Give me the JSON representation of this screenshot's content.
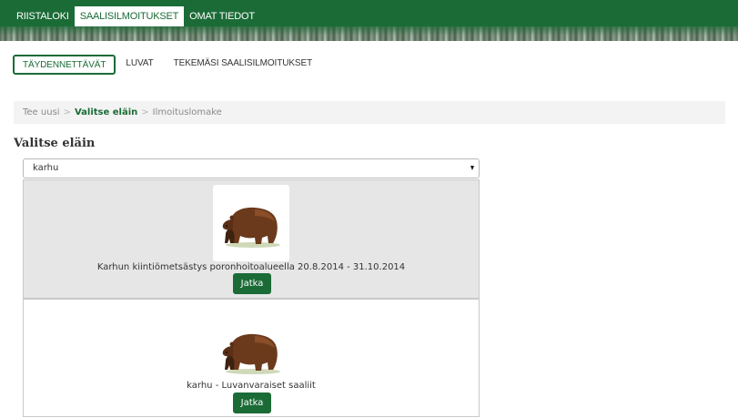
{
  "top_nav": {
    "items": [
      {
        "label": "RIISTALOKI"
      },
      {
        "label": "SAALISILMOITUKSET",
        "active": true
      },
      {
        "label": "OMAT TIEDOT"
      }
    ]
  },
  "sub_nav": {
    "tabs": [
      {
        "label": "TÄYDENNETTÄVÄT",
        "active": true
      },
      {
        "label": "LUVAT"
      },
      {
        "label": "TEKEMÄSI SAALISILMOITUKSET"
      }
    ]
  },
  "breadcrumb": {
    "items": [
      "Tee uusi",
      "Valitse eläin",
      "Ilmoituslomake"
    ],
    "separator": ">"
  },
  "section": {
    "title": "Valitse eläin"
  },
  "animal_select": {
    "value": "karhu"
  },
  "results": [
    {
      "title": "Karhun kiintiömetsästys poronhoitoalueella 20.8.2014 - 31.10.2014",
      "button": "Jatka",
      "icon": "bear-icon",
      "highlighted": true
    },
    {
      "title": "karhu - Luvanvaraiset saaliit",
      "button": "Jatka",
      "icon": "bear-icon",
      "highlighted": false
    }
  ],
  "colors": {
    "brand_green": "#1b6b37",
    "breadcrumb_bg": "#f3f3f3",
    "highlight_bg": "#e6e6e6"
  }
}
